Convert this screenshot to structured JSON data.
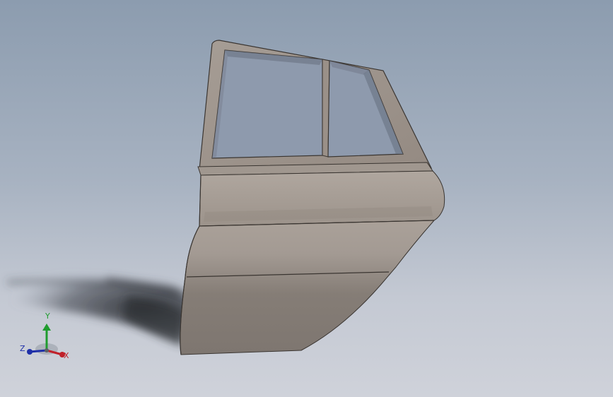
{
  "viewport": {
    "background_top": "#8c9caf",
    "background_bottom": "#cfd2da"
  },
  "model": {
    "part": "rear car door",
    "body_color": "#a49b94",
    "frame_color": "#9c928a",
    "glass_color": "#8f9bae",
    "edge_color": "#3a3531"
  },
  "triad": {
    "x_label": "X",
    "y_label": "Y",
    "z_label": "Z",
    "x_color": "#c0202a",
    "y_color": "#1f9c2e",
    "z_color": "#1e2fa8"
  }
}
